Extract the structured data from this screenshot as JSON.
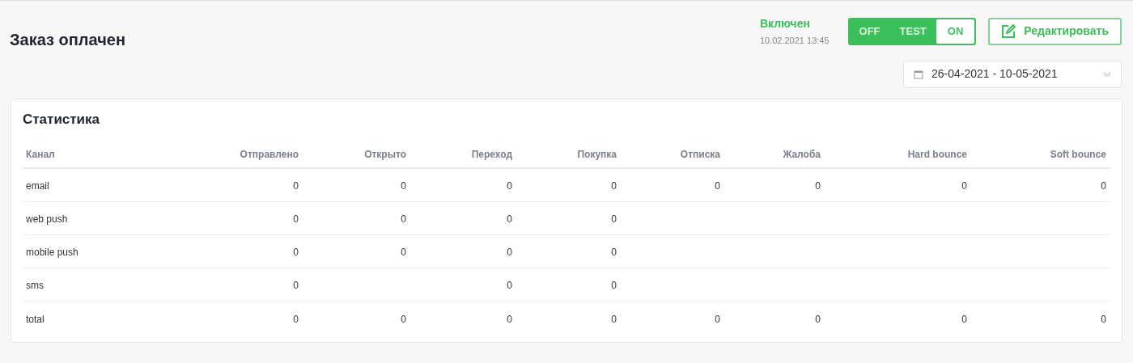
{
  "title": "Заказ оплачен",
  "status": {
    "label": "Включен",
    "timestamp": "10.02.2021 13:45"
  },
  "mode_toggle": [
    {
      "label": "OFF",
      "selected": false
    },
    {
      "label": "TEST",
      "selected": false
    },
    {
      "label": "ON",
      "selected": true
    }
  ],
  "edit_button": "Редактировать",
  "date_range": "26-04-2021 - 10-05-2021",
  "statistics": {
    "title": "Статистика",
    "columns": [
      "Канал",
      "Отправлено",
      "Открыто",
      "Переход",
      "Покупка",
      "Отписка",
      "Жалоба",
      "Hard bounce",
      "Soft bounce"
    ],
    "rows": [
      [
        "email",
        "0",
        "0",
        "0",
        "0",
        "0",
        "0",
        "0",
        "0"
      ],
      [
        "web push",
        "0",
        "0",
        "0",
        "0",
        null,
        null,
        null,
        null
      ],
      [
        "mobile push",
        "0",
        "0",
        "0",
        "0",
        null,
        null,
        null,
        null
      ],
      [
        "sms",
        "0",
        null,
        "0",
        "0",
        null,
        null,
        null,
        null
      ],
      [
        "total",
        "0",
        "0",
        "0",
        "0",
        "0",
        "0",
        "0",
        "0"
      ]
    ]
  }
}
